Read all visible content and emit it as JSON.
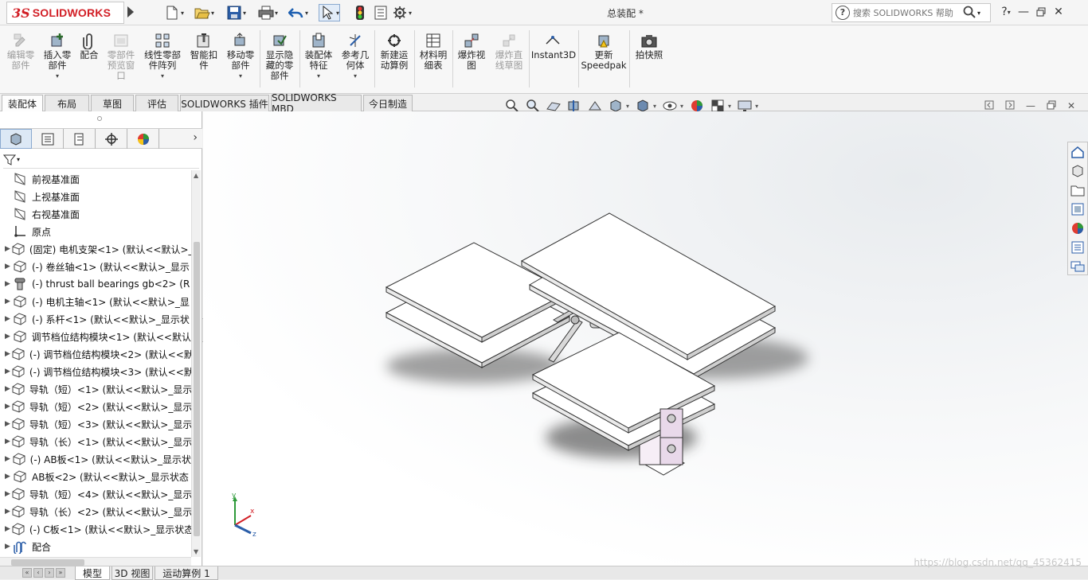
{
  "titlebar": {
    "logo_ds": "3S",
    "logo_text": "SOLIDWORKS",
    "document_title": "总装配 *",
    "help_search_placeholder": "搜索 SOLIDWORKS 帮助",
    "help_icon": "?",
    "question_menu": "?"
  },
  "commands": [
    {
      "id": "edit-part",
      "label": "编辑零\n部件",
      "icon": "edit-component-icon",
      "disabled": true
    },
    {
      "id": "insert-part",
      "label": "插入零\n部件",
      "icon": "insert-component-icon",
      "disabled": false,
      "dropdown": true
    },
    {
      "id": "mate",
      "label": "配合",
      "icon": "mate-icon",
      "disabled": false
    },
    {
      "id": "preview-window",
      "label": "零部件\n预览窗\n口",
      "icon": "preview-window-icon",
      "disabled": true
    },
    {
      "id": "linear-pattern",
      "label": "线性零部\n件阵列",
      "icon": "linear-pattern-icon",
      "disabled": false,
      "dropdown": true
    },
    {
      "id": "smart-fastener",
      "label": "智能扣\n件",
      "icon": "smart-fastener-icon",
      "disabled": false
    },
    {
      "id": "move-component",
      "label": "移动零\n部件",
      "icon": "move-component-icon",
      "disabled": false,
      "dropdown": true
    },
    {
      "id": "show-hidden",
      "label": "显示隐\n藏的零\n部件",
      "icon": "show-hidden-icon",
      "disabled": false
    },
    {
      "id": "assembly-feature",
      "label": "装配体\n特征",
      "icon": "assembly-feature-icon",
      "disabled": false,
      "dropdown": true
    },
    {
      "id": "reference-geometry",
      "label": "参考几\n何体",
      "icon": "reference-geometry-icon",
      "disabled": false,
      "dropdown": true
    },
    {
      "id": "new-motion-study",
      "label": "新建运\n动算例",
      "icon": "motion-study-icon",
      "disabled": false
    },
    {
      "id": "bom",
      "label": "材料明\n细表",
      "icon": "bom-icon",
      "disabled": false
    },
    {
      "id": "exploded-view",
      "label": "爆炸视\n图",
      "icon": "exploded-view-icon",
      "disabled": false
    },
    {
      "id": "explode-line",
      "label": "爆炸直\n线草图",
      "icon": "explode-line-icon",
      "disabled": true
    },
    {
      "id": "instant3d",
      "label": "Instant3D",
      "icon": "instant3d-icon",
      "disabled": false
    },
    {
      "id": "speedpak",
      "label": "更新\nSpeedpak",
      "icon": "speedpak-icon",
      "disabled": false
    },
    {
      "id": "snapshot",
      "label": "拍快照",
      "icon": "camera-icon",
      "disabled": false
    }
  ],
  "tabs": [
    "装配体",
    "布局",
    "草图",
    "评估",
    "SOLIDWORKS 插件",
    "SOLIDWORKS MBD",
    "今日制造"
  ],
  "feature_tree": [
    {
      "label": "前视基准面",
      "icon": "plane-icon",
      "expandable": false
    },
    {
      "label": "上视基准面",
      "icon": "plane-icon",
      "expandable": false
    },
    {
      "label": "右视基准面",
      "icon": "plane-icon",
      "expandable": false
    },
    {
      "label": "原点",
      "icon": "origin-icon",
      "expandable": false
    },
    {
      "label": "(固定) 电机支架<1> (默认<<默认>_",
      "icon": "part-icon",
      "expandable": true
    },
    {
      "label": "(-) 卷丝轴<1> (默认<<默认>_显示",
      "icon": "part-icon",
      "expandable": true
    },
    {
      "label": "(-) thrust ball bearings gb<2> (R",
      "icon": "bearing-icon",
      "expandable": true
    },
    {
      "label": "(-) 电机主轴<1> (默认<<默认>_显",
      "icon": "part-icon",
      "expandable": true
    },
    {
      "label": "(-) 系杆<1> (默认<<默认>_显示状",
      "icon": "part-icon",
      "expandable": true
    },
    {
      "label": "调节档位结构模块<1> (默认<<默认",
      "icon": "part-icon",
      "expandable": true
    },
    {
      "label": "(-) 调节档位结构模块<2> (默认<<默",
      "icon": "part-icon",
      "expandable": true
    },
    {
      "label": "(-) 调节档位结构模块<3> (默认<<默",
      "icon": "part-icon",
      "expandable": true
    },
    {
      "label": "导轨（短）<1> (默认<<默认>_显示",
      "icon": "part-icon",
      "expandable": true
    },
    {
      "label": "导轨（短）<2> (默认<<默认>_显示",
      "icon": "part-icon",
      "expandable": true
    },
    {
      "label": "导轨（短）<3> (默认<<默认>_显示",
      "icon": "part-icon",
      "expandable": true
    },
    {
      "label": "导轨（长）<1> (默认<<默认>_显示",
      "icon": "part-icon",
      "expandable": true
    },
    {
      "label": "(-) AB板<1> (默认<<默认>_显示状",
      "icon": "part-icon",
      "expandable": true
    },
    {
      "label": "AB板<2> (默认<<默认>_显示状态",
      "icon": "part-icon",
      "expandable": true
    },
    {
      "label": "导轨（短）<4> (默认<<默认>_显示",
      "icon": "part-icon",
      "expandable": true
    },
    {
      "label": "导轨（长）<2> (默认<<默认>_显示",
      "icon": "part-icon",
      "expandable": true
    },
    {
      "label": "(-) C板<1> (默认<<默认>_显示状态",
      "icon": "part-icon",
      "expandable": true
    },
    {
      "label": "配合",
      "icon": "mates-folder-icon",
      "expandable": true
    }
  ],
  "bottom_tabs": [
    "模型",
    "3D 视图",
    "运动算例 1"
  ],
  "triad": {
    "x": "x",
    "y": "y",
    "z": "z"
  },
  "watermark": "https://blog.csdn.net/qq_45362415"
}
